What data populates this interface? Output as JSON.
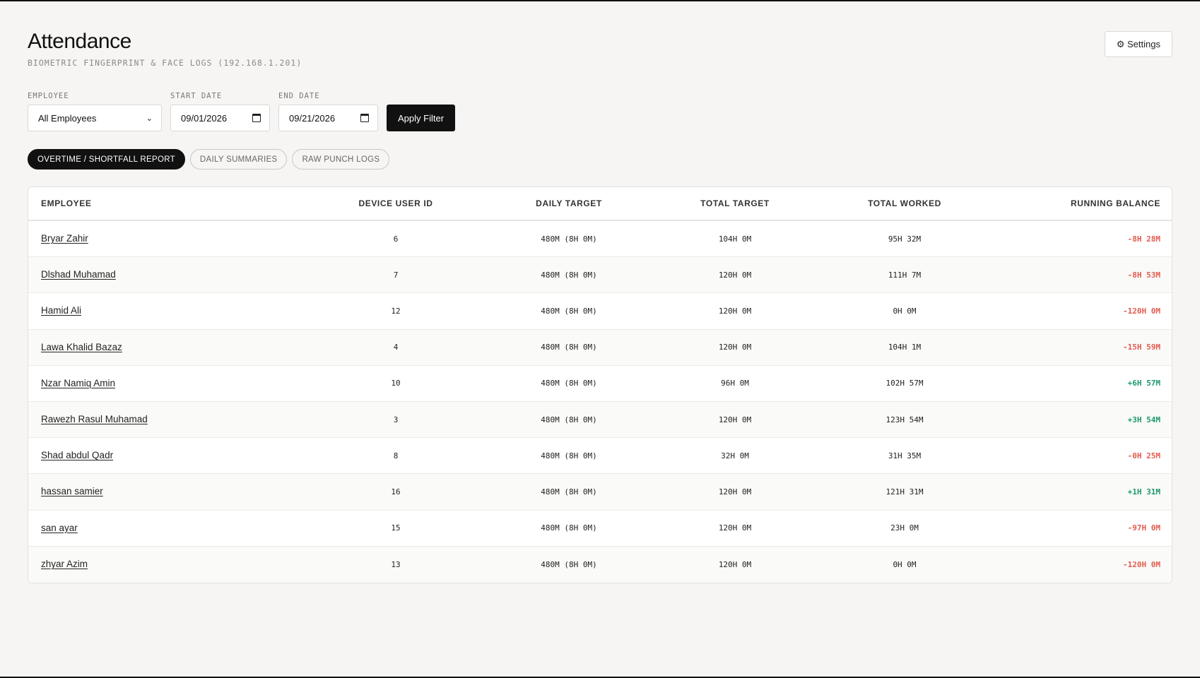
{
  "header": {
    "title": "Attendance",
    "subtitle": "BIOMETRIC FINGERPRINT & FACE LOGS (192.168.1.201)",
    "settings_label": "⚙ Settings"
  },
  "filters": {
    "employee_label": "EMPLOYEE",
    "employee_value": "All Employees",
    "start_label": "START DATE",
    "start_value": "09/01/2026",
    "end_label": "END DATE",
    "end_value": "09/21/2026",
    "apply_label": "Apply Filter"
  },
  "tabs": [
    {
      "label": "OVERTIME / SHORTFALL REPORT",
      "active": true
    },
    {
      "label": "DAILY SUMMARIES",
      "active": false
    },
    {
      "label": "RAW PUNCH LOGS",
      "active": false
    }
  ],
  "table": {
    "columns": [
      "EMPLOYEE",
      "DEVICE USER ID",
      "DAILY TARGET",
      "TOTAL TARGET",
      "TOTAL WORKED",
      "RUNNING BALANCE"
    ],
    "rows": [
      {
        "name": "Bryar Zahir",
        "id": "6",
        "daily": "480M (8H 0M)",
        "target": "104H 0M",
        "worked": "95H 32M",
        "balance": "-8H 28M",
        "sign": "neg"
      },
      {
        "name": "Dlshad Muhamad",
        "id": "7",
        "daily": "480M (8H 0M)",
        "target": "120H 0M",
        "worked": "111H 7M",
        "balance": "-8H 53M",
        "sign": "neg"
      },
      {
        "name": "Hamid Ali",
        "id": "12",
        "daily": "480M (8H 0M)",
        "target": "120H 0M",
        "worked": "0H 0M",
        "balance": "-120H 0M",
        "sign": "neg"
      },
      {
        "name": "Lawa Khalid Bazaz",
        "id": "4",
        "daily": "480M (8H 0M)",
        "target": "120H 0M",
        "worked": "104H 1M",
        "balance": "-15H 59M",
        "sign": "neg"
      },
      {
        "name": "Nzar Namiq Amin",
        "id": "10",
        "daily": "480M (8H 0M)",
        "target": "96H 0M",
        "worked": "102H 57M",
        "balance": "+6H 57M",
        "sign": "pos"
      },
      {
        "name": "Rawezh Rasul Muhamad",
        "id": "3",
        "daily": "480M (8H 0M)",
        "target": "120H 0M",
        "worked": "123H 54M",
        "balance": "+3H 54M",
        "sign": "pos"
      },
      {
        "name": "Shad abdul Qadr",
        "id": "8",
        "daily": "480M (8H 0M)",
        "target": "32H 0M",
        "worked": "31H 35M",
        "balance": "-0H 25M",
        "sign": "neg"
      },
      {
        "name": "hassan samier",
        "id": "16",
        "daily": "480M (8H 0M)",
        "target": "120H 0M",
        "worked": "121H 31M",
        "balance": "+1H 31M",
        "sign": "pos"
      },
      {
        "name": "san ayar",
        "id": "15",
        "daily": "480M (8H 0M)",
        "target": "120H 0M",
        "worked": "23H 0M",
        "balance": "-97H 0M",
        "sign": "neg"
      },
      {
        "name": "zhyar Azim",
        "id": "13",
        "daily": "480M (8H 0M)",
        "target": "120H 0M",
        "worked": "0H 0M",
        "balance": "-120H 0M",
        "sign": "neg"
      }
    ]
  },
  "colors": {
    "negative": "#e35b4f",
    "positive": "#1d9a6c",
    "accent": "#111111"
  }
}
